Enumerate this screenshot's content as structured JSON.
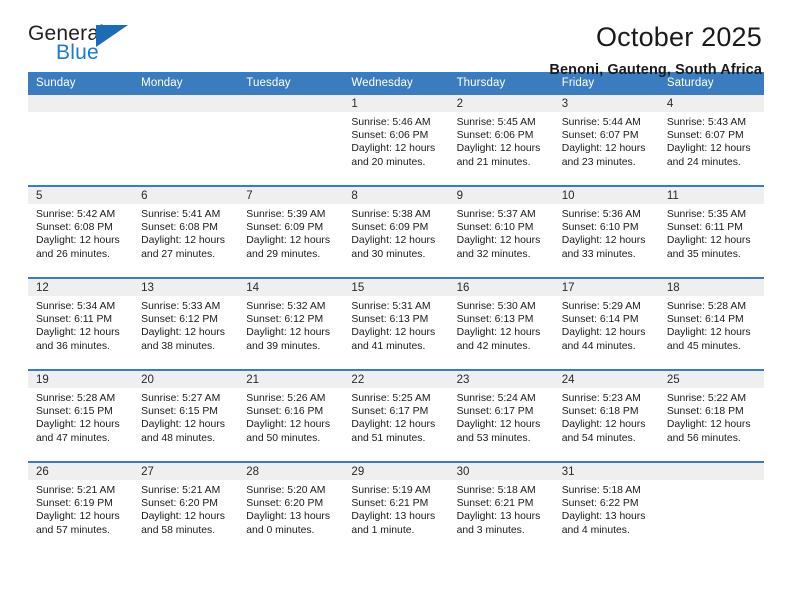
{
  "brand": {
    "name_part1": "General",
    "name_part2": "Blue",
    "triangle_color": "#1b6cb3",
    "blue_color": "#1f7ac4"
  },
  "header": {
    "title": "October 2025",
    "subtitle": "Benoni, Gauteng, South Africa"
  },
  "theme": {
    "header_blue": "#3b7cbf",
    "daynum_band": "#efefef",
    "text": "#1a1a1a"
  },
  "calendar": {
    "weekdays": [
      "Sunday",
      "Monday",
      "Tuesday",
      "Wednesday",
      "Thursday",
      "Friday",
      "Saturday"
    ],
    "weeks": [
      [
        {
          "day": "",
          "empty": true
        },
        {
          "day": "",
          "empty": true
        },
        {
          "day": "",
          "empty": true
        },
        {
          "day": "1",
          "sunrise": "Sunrise: 5:46 AM",
          "sunset": "Sunset: 6:06 PM",
          "daylight1": "Daylight: 12 hours",
          "daylight2": "and 20 minutes."
        },
        {
          "day": "2",
          "sunrise": "Sunrise: 5:45 AM",
          "sunset": "Sunset: 6:06 PM",
          "daylight1": "Daylight: 12 hours",
          "daylight2": "and 21 minutes."
        },
        {
          "day": "3",
          "sunrise": "Sunrise: 5:44 AM",
          "sunset": "Sunset: 6:07 PM",
          "daylight1": "Daylight: 12 hours",
          "daylight2": "and 23 minutes."
        },
        {
          "day": "4",
          "sunrise": "Sunrise: 5:43 AM",
          "sunset": "Sunset: 6:07 PM",
          "daylight1": "Daylight: 12 hours",
          "daylight2": "and 24 minutes."
        }
      ],
      [
        {
          "day": "5",
          "sunrise": "Sunrise: 5:42 AM",
          "sunset": "Sunset: 6:08 PM",
          "daylight1": "Daylight: 12 hours",
          "daylight2": "and 26 minutes."
        },
        {
          "day": "6",
          "sunrise": "Sunrise: 5:41 AM",
          "sunset": "Sunset: 6:08 PM",
          "daylight1": "Daylight: 12 hours",
          "daylight2": "and 27 minutes."
        },
        {
          "day": "7",
          "sunrise": "Sunrise: 5:39 AM",
          "sunset": "Sunset: 6:09 PM",
          "daylight1": "Daylight: 12 hours",
          "daylight2": "and 29 minutes."
        },
        {
          "day": "8",
          "sunrise": "Sunrise: 5:38 AM",
          "sunset": "Sunset: 6:09 PM",
          "daylight1": "Daylight: 12 hours",
          "daylight2": "and 30 minutes."
        },
        {
          "day": "9",
          "sunrise": "Sunrise: 5:37 AM",
          "sunset": "Sunset: 6:10 PM",
          "daylight1": "Daylight: 12 hours",
          "daylight2": "and 32 minutes."
        },
        {
          "day": "10",
          "sunrise": "Sunrise: 5:36 AM",
          "sunset": "Sunset: 6:10 PM",
          "daylight1": "Daylight: 12 hours",
          "daylight2": "and 33 minutes."
        },
        {
          "day": "11",
          "sunrise": "Sunrise: 5:35 AM",
          "sunset": "Sunset: 6:11 PM",
          "daylight1": "Daylight: 12 hours",
          "daylight2": "and 35 minutes."
        }
      ],
      [
        {
          "day": "12",
          "sunrise": "Sunrise: 5:34 AM",
          "sunset": "Sunset: 6:11 PM",
          "daylight1": "Daylight: 12 hours",
          "daylight2": "and 36 minutes."
        },
        {
          "day": "13",
          "sunrise": "Sunrise: 5:33 AM",
          "sunset": "Sunset: 6:12 PM",
          "daylight1": "Daylight: 12 hours",
          "daylight2": "and 38 minutes."
        },
        {
          "day": "14",
          "sunrise": "Sunrise: 5:32 AM",
          "sunset": "Sunset: 6:12 PM",
          "daylight1": "Daylight: 12 hours",
          "daylight2": "and 39 minutes."
        },
        {
          "day": "15",
          "sunrise": "Sunrise: 5:31 AM",
          "sunset": "Sunset: 6:13 PM",
          "daylight1": "Daylight: 12 hours",
          "daylight2": "and 41 minutes."
        },
        {
          "day": "16",
          "sunrise": "Sunrise: 5:30 AM",
          "sunset": "Sunset: 6:13 PM",
          "daylight1": "Daylight: 12 hours",
          "daylight2": "and 42 minutes."
        },
        {
          "day": "17",
          "sunrise": "Sunrise: 5:29 AM",
          "sunset": "Sunset: 6:14 PM",
          "daylight1": "Daylight: 12 hours",
          "daylight2": "and 44 minutes."
        },
        {
          "day": "18",
          "sunrise": "Sunrise: 5:28 AM",
          "sunset": "Sunset: 6:14 PM",
          "daylight1": "Daylight: 12 hours",
          "daylight2": "and 45 minutes."
        }
      ],
      [
        {
          "day": "19",
          "sunrise": "Sunrise: 5:28 AM",
          "sunset": "Sunset: 6:15 PM",
          "daylight1": "Daylight: 12 hours",
          "daylight2": "and 47 minutes."
        },
        {
          "day": "20",
          "sunrise": "Sunrise: 5:27 AM",
          "sunset": "Sunset: 6:15 PM",
          "daylight1": "Daylight: 12 hours",
          "daylight2": "and 48 minutes."
        },
        {
          "day": "21",
          "sunrise": "Sunrise: 5:26 AM",
          "sunset": "Sunset: 6:16 PM",
          "daylight1": "Daylight: 12 hours",
          "daylight2": "and 50 minutes."
        },
        {
          "day": "22",
          "sunrise": "Sunrise: 5:25 AM",
          "sunset": "Sunset: 6:17 PM",
          "daylight1": "Daylight: 12 hours",
          "daylight2": "and 51 minutes."
        },
        {
          "day": "23",
          "sunrise": "Sunrise: 5:24 AM",
          "sunset": "Sunset: 6:17 PM",
          "daylight1": "Daylight: 12 hours",
          "daylight2": "and 53 minutes."
        },
        {
          "day": "24",
          "sunrise": "Sunrise: 5:23 AM",
          "sunset": "Sunset: 6:18 PM",
          "daylight1": "Daylight: 12 hours",
          "daylight2": "and 54 minutes."
        },
        {
          "day": "25",
          "sunrise": "Sunrise: 5:22 AM",
          "sunset": "Sunset: 6:18 PM",
          "daylight1": "Daylight: 12 hours",
          "daylight2": "and 56 minutes."
        }
      ],
      [
        {
          "day": "26",
          "sunrise": "Sunrise: 5:21 AM",
          "sunset": "Sunset: 6:19 PM",
          "daylight1": "Daylight: 12 hours",
          "daylight2": "and 57 minutes."
        },
        {
          "day": "27",
          "sunrise": "Sunrise: 5:21 AM",
          "sunset": "Sunset: 6:20 PM",
          "daylight1": "Daylight: 12 hours",
          "daylight2": "and 58 minutes."
        },
        {
          "day": "28",
          "sunrise": "Sunrise: 5:20 AM",
          "sunset": "Sunset: 6:20 PM",
          "daylight1": "Daylight: 13 hours",
          "daylight2": "and 0 minutes."
        },
        {
          "day": "29",
          "sunrise": "Sunrise: 5:19 AM",
          "sunset": "Sunset: 6:21 PM",
          "daylight1": "Daylight: 13 hours",
          "daylight2": "and 1 minute."
        },
        {
          "day": "30",
          "sunrise": "Sunrise: 5:18 AM",
          "sunset": "Sunset: 6:21 PM",
          "daylight1": "Daylight: 13 hours",
          "daylight2": "and 3 minutes."
        },
        {
          "day": "31",
          "sunrise": "Sunrise: 5:18 AM",
          "sunset": "Sunset: 6:22 PM",
          "daylight1": "Daylight: 13 hours",
          "daylight2": "and 4 minutes."
        },
        {
          "day": "",
          "empty": true
        }
      ]
    ]
  }
}
